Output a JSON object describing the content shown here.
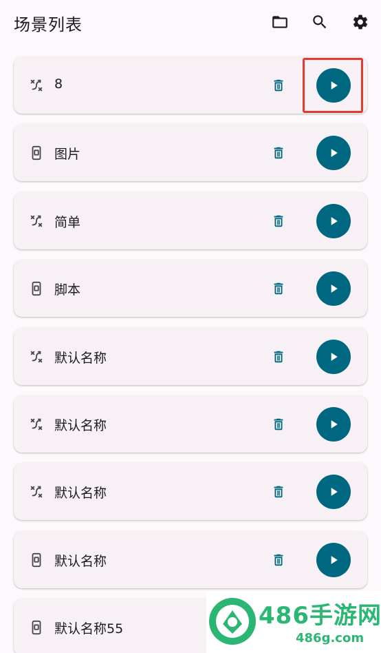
{
  "header": {
    "title": "场景列表",
    "icons": [
      "folder-open-icon",
      "search-icon",
      "settings-gear-icon"
    ]
  },
  "colors": {
    "background": "#fdf8fb",
    "card": "#f7f1f6",
    "accent": "#006780",
    "highlight": "#e23b2a",
    "fab": "#c8ebf7"
  },
  "scenes": [
    {
      "name": "8",
      "type_icon": "shuffle-icon"
    },
    {
      "name": "图片",
      "type_icon": "phone-screen-icon"
    },
    {
      "name": "简单",
      "type_icon": "shuffle-icon"
    },
    {
      "name": "脚本",
      "type_icon": "phone-screen-icon"
    },
    {
      "name": "默认名称",
      "type_icon": "shuffle-icon"
    },
    {
      "name": "默认名称",
      "type_icon": "shuffle-icon"
    },
    {
      "name": "默认名称",
      "type_icon": "shuffle-icon"
    },
    {
      "name": "默认名称",
      "type_icon": "phone-screen-icon"
    },
    {
      "name": "默认名称55",
      "type_icon": "phone-screen-icon"
    }
  ],
  "watermark": {
    "brand": "486手游网",
    "url": "486g.com"
  }
}
